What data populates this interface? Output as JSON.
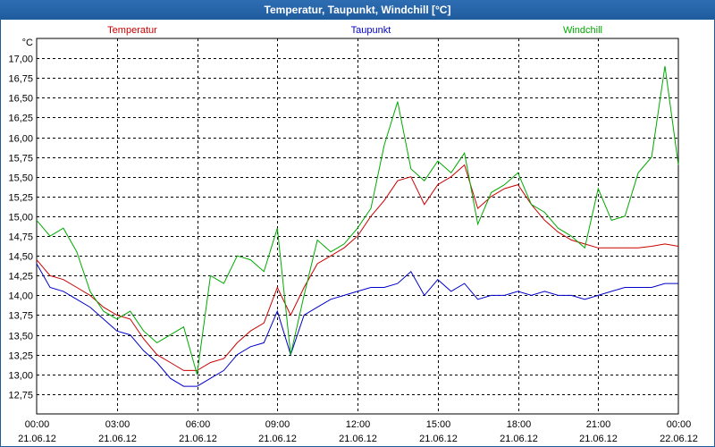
{
  "window": {
    "title": "Temperatur, Taupunkt, Windchill [°C]"
  },
  "chart_data": {
    "type": "line",
    "title": "Temperatur, Taupunkt, Windchill [°C]",
    "unit_label": "°C",
    "ylim": [
      12.5,
      17.25
    ],
    "y_ticks": [
      "17,00",
      "16,75",
      "16,50",
      "16,25",
      "16,00",
      "15,75",
      "15,50",
      "15,25",
      "15,00",
      "14,75",
      "14,50",
      "14,25",
      "14,00",
      "13,75",
      "13,50",
      "13,25",
      "13,00",
      "12,75"
    ],
    "x_ticks": [
      {
        "time": "00:00",
        "date": "21.06.12"
      },
      {
        "time": "03:00",
        "date": "21.06.12"
      },
      {
        "time": "06:00",
        "date": "21.06.12"
      },
      {
        "time": "09:00",
        "date": "21.06.12"
      },
      {
        "time": "12:00",
        "date": "21.06.12"
      },
      {
        "time": "15:00",
        "date": "21.06.12"
      },
      {
        "time": "18:00",
        "date": "21.06.12"
      },
      {
        "time": "21:00",
        "date": "21.06.12"
      },
      {
        "time": "00:00",
        "date": "22.06.12"
      }
    ],
    "grid": true,
    "legend_position": "top",
    "series": [
      {
        "name": "Temperatur",
        "color": "#cc0000",
        "points": [
          [
            0,
            14.45
          ],
          [
            0.5,
            14.25
          ],
          [
            1,
            14.2
          ],
          [
            1.5,
            14.1
          ],
          [
            2,
            14.0
          ],
          [
            2.5,
            13.85
          ],
          [
            3,
            13.75
          ],
          [
            3.5,
            13.7
          ],
          [
            4,
            13.45
          ],
          [
            4.5,
            13.25
          ],
          [
            5,
            13.15
          ],
          [
            5.5,
            13.05
          ],
          [
            6,
            13.05
          ],
          [
            6.5,
            13.15
          ],
          [
            7,
            13.2
          ],
          [
            7.5,
            13.4
          ],
          [
            8,
            13.55
          ],
          [
            8.5,
            13.65
          ],
          [
            9,
            14.1
          ],
          [
            9.5,
            13.75
          ],
          [
            10,
            14.1
          ],
          [
            10.5,
            14.4
          ],
          [
            11,
            14.5
          ],
          [
            11.5,
            14.6
          ],
          [
            12,
            14.75
          ],
          [
            12.5,
            15.0
          ],
          [
            13,
            15.2
          ],
          [
            13.5,
            15.45
          ],
          [
            14,
            15.5
          ],
          [
            14.5,
            15.15
          ],
          [
            15,
            15.4
          ],
          [
            15.5,
            15.5
          ],
          [
            16,
            15.65
          ],
          [
            16.5,
            15.1
          ],
          [
            17,
            15.25
          ],
          [
            17.5,
            15.35
          ],
          [
            18,
            15.4
          ],
          [
            18.5,
            15.15
          ],
          [
            19,
            14.95
          ],
          [
            19.5,
            14.8
          ],
          [
            20,
            14.7
          ],
          [
            20.5,
            14.65
          ],
          [
            21,
            14.6
          ],
          [
            21.5,
            14.6
          ],
          [
            22,
            14.6
          ],
          [
            22.5,
            14.6
          ],
          [
            23,
            14.62
          ],
          [
            23.5,
            14.65
          ],
          [
            24,
            14.62
          ]
        ]
      },
      {
        "name": "Taupunkt",
        "color": "#0000cc",
        "points": [
          [
            0,
            14.4
          ],
          [
            0.5,
            14.1
          ],
          [
            1,
            14.05
          ],
          [
            1.5,
            13.95
          ],
          [
            2,
            13.85
          ],
          [
            2.5,
            13.7
          ],
          [
            3,
            13.55
          ],
          [
            3.5,
            13.5
          ],
          [
            4,
            13.3
          ],
          [
            4.5,
            13.15
          ],
          [
            5,
            12.95
          ],
          [
            5.5,
            12.85
          ],
          [
            6,
            12.85
          ],
          [
            6.5,
            12.95
          ],
          [
            7,
            13.05
          ],
          [
            7.5,
            13.25
          ],
          [
            8,
            13.35
          ],
          [
            8.5,
            13.4
          ],
          [
            9,
            13.8
          ],
          [
            9.5,
            13.25
          ],
          [
            10,
            13.75
          ],
          [
            10.5,
            13.85
          ],
          [
            11,
            13.95
          ],
          [
            11.5,
            14.0
          ],
          [
            12,
            14.05
          ],
          [
            12.5,
            14.1
          ],
          [
            13,
            14.1
          ],
          [
            13.5,
            14.15
          ],
          [
            14,
            14.3
          ],
          [
            14.5,
            14.0
          ],
          [
            15,
            14.2
          ],
          [
            15.5,
            14.05
          ],
          [
            16,
            14.15
          ],
          [
            16.5,
            13.95
          ],
          [
            17,
            14.0
          ],
          [
            17.5,
            14.0
          ],
          [
            18,
            14.05
          ],
          [
            18.5,
            14.0
          ],
          [
            19,
            14.05
          ],
          [
            19.5,
            14.0
          ],
          [
            20,
            14.0
          ],
          [
            20.5,
            13.95
          ],
          [
            21,
            14.0
          ],
          [
            21.5,
            14.05
          ],
          [
            22,
            14.1
          ],
          [
            22.5,
            14.1
          ],
          [
            23,
            14.1
          ],
          [
            23.5,
            14.15
          ],
          [
            24,
            14.15
          ]
        ]
      },
      {
        "name": "Windchill",
        "color": "#00aa00",
        "points": [
          [
            0,
            14.95
          ],
          [
            0.5,
            14.75
          ],
          [
            1,
            14.85
          ],
          [
            1.5,
            14.55
          ],
          [
            2,
            14.05
          ],
          [
            2.5,
            13.8
          ],
          [
            3,
            13.7
          ],
          [
            3.5,
            13.8
          ],
          [
            4,
            13.55
          ],
          [
            4.5,
            13.4
          ],
          [
            5,
            13.5
          ],
          [
            5.5,
            13.6
          ],
          [
            6,
            13.0
          ],
          [
            6.5,
            14.25
          ],
          [
            7,
            14.15
          ],
          [
            7.5,
            14.5
          ],
          [
            8,
            14.45
          ],
          [
            8.5,
            14.3
          ],
          [
            9,
            14.85
          ],
          [
            9.5,
            13.25
          ],
          [
            10,
            14.0
          ],
          [
            10.5,
            14.7
          ],
          [
            11,
            14.55
          ],
          [
            11.5,
            14.65
          ],
          [
            12,
            14.85
          ],
          [
            12.5,
            15.1
          ],
          [
            13,
            15.9
          ],
          [
            13.5,
            16.45
          ],
          [
            14,
            15.6
          ],
          [
            14.5,
            15.45
          ],
          [
            15,
            15.7
          ],
          [
            15.5,
            15.55
          ],
          [
            16,
            15.8
          ],
          [
            16.5,
            14.9
          ],
          [
            17,
            15.3
          ],
          [
            17.5,
            15.4
          ],
          [
            18,
            15.55
          ],
          [
            18.5,
            15.15
          ],
          [
            19,
            15.05
          ],
          [
            19.5,
            14.85
          ],
          [
            20,
            14.75
          ],
          [
            20.5,
            14.6
          ],
          [
            21,
            15.35
          ],
          [
            21.5,
            14.95
          ],
          [
            22,
            15.0
          ],
          [
            22.5,
            15.55
          ],
          [
            23,
            15.75
          ],
          [
            23.5,
            16.9
          ],
          [
            24,
            15.65
          ]
        ]
      }
    ]
  }
}
